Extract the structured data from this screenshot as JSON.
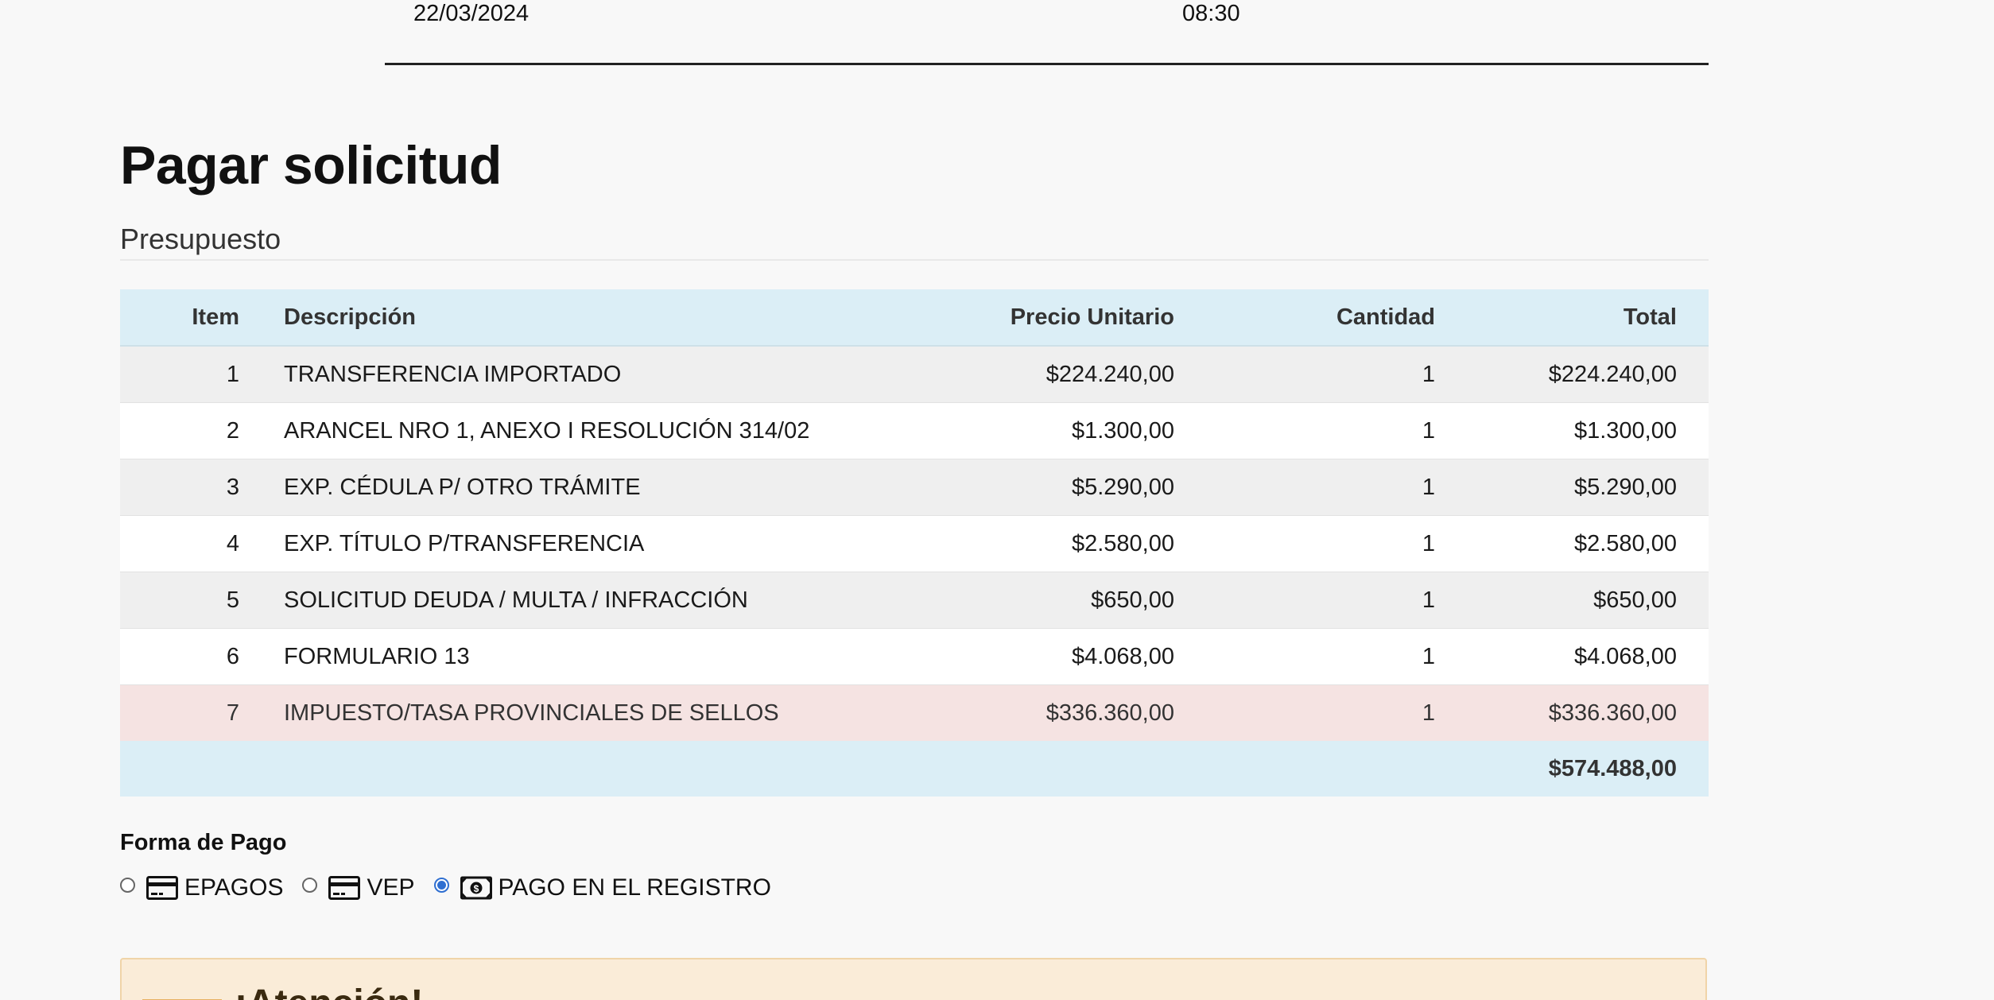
{
  "header": {
    "date": "22/03/2024",
    "time": "08:30"
  },
  "page": {
    "title": "Pagar solicitud",
    "subtitle": "Presupuesto"
  },
  "table": {
    "headers": {
      "item": "Item",
      "description": "Descripción",
      "unit_price": "Precio Unitario",
      "quantity": "Cantidad",
      "total": "Total"
    },
    "rows": [
      {
        "item": "1",
        "description": "TRANSFERENCIA IMPORTADO",
        "unit_price": "$224.240,00",
        "quantity": "1",
        "total": "$224.240,00"
      },
      {
        "item": "2",
        "description": "ARANCEL NRO 1, ANEXO I RESOLUCIÓN 314/02",
        "unit_price": "$1.300,00",
        "quantity": "1",
        "total": "$1.300,00"
      },
      {
        "item": "3",
        "description": "EXP. CÉDULA P/ OTRO TRÁMITE",
        "unit_price": "$5.290,00",
        "quantity": "1",
        "total": "$5.290,00"
      },
      {
        "item": "4",
        "description": "EXP. TÍTULO P/TRANSFERENCIA",
        "unit_price": "$2.580,00",
        "quantity": "1",
        "total": "$2.580,00"
      },
      {
        "item": "5",
        "description": "SOLICITUD DEUDA / MULTA / INFRACCIÓN",
        "unit_price": "$650,00",
        "quantity": "1",
        "total": "$650,00"
      },
      {
        "item": "6",
        "description": "FORMULARIO 13",
        "unit_price": "$4.068,00",
        "quantity": "1",
        "total": "$4.068,00"
      },
      {
        "item": "7",
        "description": "IMPUESTO/TASA PROVINCIALES DE SELLOS",
        "unit_price": "$336.360,00",
        "quantity": "1",
        "total": "$336.360,00"
      }
    ],
    "grand_total": "$574.488,00"
  },
  "payment": {
    "label": "Forma de Pago",
    "options": [
      {
        "label": "EPAGOS",
        "icon": "credit-card-icon",
        "selected": false
      },
      {
        "label": "VEP",
        "icon": "credit-card-icon",
        "selected": false
      },
      {
        "label": "PAGO EN EL REGISTRO",
        "icon": "cash-bill-icon",
        "selected": true
      }
    ]
  },
  "alert": {
    "title": "¡Atención!"
  },
  "colors": {
    "table_header_bg": "#dbeef6",
    "danger_row_bg": "#f5e3e2",
    "alert_bg": "#faecd8",
    "radio_accent": "#2f6fd1"
  }
}
